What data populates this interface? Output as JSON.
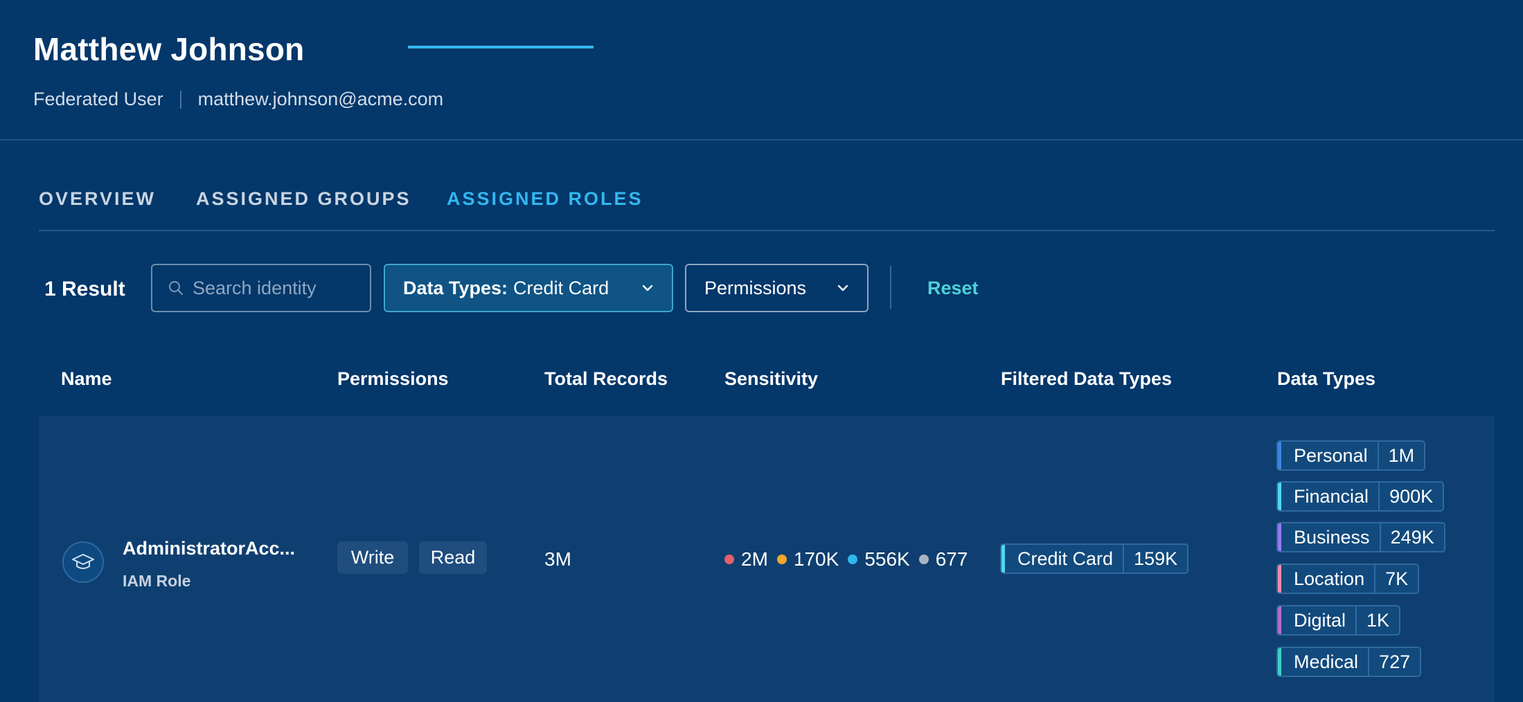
{
  "header": {
    "name": "Matthew Johnson",
    "user_type": "Federated User",
    "email": "matthew.johnson@acme.com"
  },
  "tabs": [
    {
      "label": "OVERVIEW",
      "active": false
    },
    {
      "label": "ASSIGNED GROUPS",
      "active": false
    },
    {
      "label": "ASSIGNED ROLES",
      "active": true
    }
  ],
  "filters": {
    "result_count": "1 Result",
    "search_placeholder": "Search identity",
    "data_types_label": "Data Types:",
    "data_types_value": "Credit Card",
    "permissions_label": "Permissions",
    "reset_label": "Reset"
  },
  "table": {
    "columns": [
      "Name",
      "Permissions",
      "Total Records",
      "Sensitivity",
      "Filtered Data Types",
      "Data Types"
    ],
    "rows": [
      {
        "name": "AdministratorAcc...",
        "type": "IAM Role",
        "avatar_icon": "graduation-cap-icon",
        "permissions": [
          "Write",
          "Read"
        ],
        "total_records": "3M",
        "sensitivity": [
          {
            "value": "2M",
            "color": "#e2606b"
          },
          {
            "value": "170K",
            "color": "#f3a72b"
          },
          {
            "value": "556K",
            "color": "#2fb8ef"
          },
          {
            "value": "677",
            "color": "#a9b4c3"
          }
        ],
        "filtered_data_types": [
          {
            "label": "Credit Card",
            "count": "159K",
            "color": "#4fd8f0"
          }
        ],
        "data_types": [
          {
            "label": "Personal",
            "count": "1M",
            "color": "#3f86e0"
          },
          {
            "label": "Financial",
            "count": "900K",
            "color": "#4fd8f0"
          },
          {
            "label": "Business",
            "count": "249K",
            "color": "#9a78f0"
          },
          {
            "label": "Location",
            "count": "7K",
            "color": "#f08aa8"
          },
          {
            "label": "Digital",
            "count": "1K",
            "color": "#b36fc8"
          },
          {
            "label": "Medical",
            "count": "727",
            "color": "#3dd1c4"
          }
        ]
      }
    ]
  }
}
